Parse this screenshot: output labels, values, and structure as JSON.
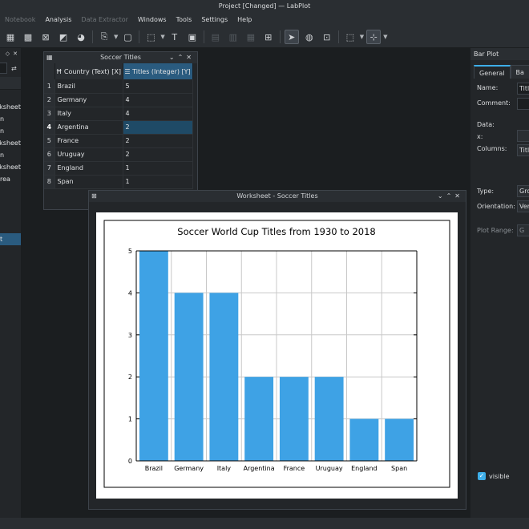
{
  "window": {
    "title": "Project [Changed] — LabPlot"
  },
  "menubar": [
    {
      "label": "Notebook",
      "disabled": true
    },
    {
      "label": "Analysis",
      "disabled": false
    },
    {
      "label": "Data Extractor",
      "disabled": true
    },
    {
      "label": "Windows",
      "disabled": false
    },
    {
      "label": "Tools",
      "disabled": false
    },
    {
      "label": "Settings",
      "disabled": false
    },
    {
      "label": "Help",
      "disabled": false
    }
  ],
  "project_explorer": {
    "rows": [
      {
        "label": "orksheet",
        "selected": false
      },
      {
        "label": "n",
        "selected": false
      },
      {
        "label": "n",
        "selected": false
      },
      {
        "label": "orksheet",
        "selected": false
      },
      {
        "label": "n",
        "selected": false
      },
      {
        "label": "orksheet",
        "selected": false
      },
      {
        "label": "rea",
        "selected": false
      },
      {
        "label": "",
        "selected": false
      },
      {
        "label": "",
        "selected": false
      },
      {
        "label": "",
        "selected": false
      },
      {
        "label": "",
        "selected": false
      },
      {
        "label": "t",
        "selected": true
      }
    ]
  },
  "spreadsheet": {
    "title": "Soccer Titles",
    "columns": [
      "Country (Text) [X]",
      "Titles (Integer) [Y]"
    ],
    "rows": [
      {
        "n": "1",
        "country": "Brazil",
        "titles": "5"
      },
      {
        "n": "2",
        "country": "Germany",
        "titles": "4"
      },
      {
        "n": "3",
        "country": "Italy",
        "titles": "4"
      },
      {
        "n": "4",
        "country": "Argentina",
        "titles": "2"
      },
      {
        "n": "5",
        "country": "France",
        "titles": "2"
      },
      {
        "n": "6",
        "country": "Uruguay",
        "titles": "2"
      },
      {
        "n": "7",
        "country": "England",
        "titles": "1"
      },
      {
        "n": "8",
        "country": "Span",
        "titles": "1"
      }
    ]
  },
  "worksheet": {
    "title": "Worksheet - Soccer Titles"
  },
  "chart_data": {
    "type": "bar",
    "title": "Soccer World Cup Titles from 1930 to 2018",
    "categories": [
      "Brazil",
      "Germany",
      "Italy",
      "Argentina",
      "France",
      "Uruguay",
      "England",
      "Span"
    ],
    "values": [
      5,
      4,
      4,
      2,
      2,
      2,
      1,
      1
    ],
    "xlabel": "",
    "ylabel": "",
    "ylim": [
      0,
      5
    ],
    "yticks": [
      "0",
      "1",
      "2",
      "3",
      "4",
      "5"
    ],
    "grid": true,
    "bar_color": "#3ea2e5"
  },
  "properties": {
    "header": "Bar Plot",
    "tabs": [
      "General",
      "Ba"
    ],
    "name_label": "Name:",
    "name_value": "Title",
    "comment_label": "Comment:",
    "data_label": "Data:",
    "x_label": "x:",
    "columns_label": "Columns:",
    "columns_value": "Title",
    "type_label": "Type:",
    "type_value": "Gro",
    "orientation_label": "Orientation:",
    "orientation_value": "Ver",
    "plot_range_label": "Plot Range:",
    "plot_range_value": "G",
    "visible_label": "visible"
  }
}
